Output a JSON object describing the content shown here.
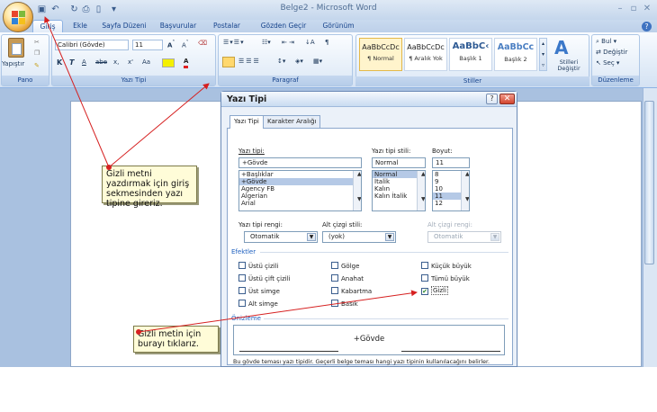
{
  "window": {
    "title": "Belge2 - Microsoft Word",
    "min": "–",
    "max": "▫",
    "close": "✕"
  },
  "tabs": [
    {
      "label": "Giriş"
    },
    {
      "label": "Ekle"
    },
    {
      "label": "Sayfa Düzeni"
    },
    {
      "label": "Başvurular"
    },
    {
      "label": "Postalar"
    },
    {
      "label": "Gözden Geçir"
    },
    {
      "label": "Görünüm"
    }
  ],
  "ribbon": {
    "pano": {
      "label": "Pano",
      "paste": "Yapıştır"
    },
    "font": {
      "label": "Yazı Tipi",
      "name": "Calibri (Gövde)",
      "size": "11",
      "bold": "K",
      "italic": "T",
      "underline": "A",
      "strike": "abe",
      "sub": "x,",
      "sup": "x'",
      "case": "Aa"
    },
    "paragraph": {
      "label": "Paragraf"
    },
    "styles": {
      "label": "Stiller",
      "items": [
        {
          "sample": "AaBbCcDc",
          "name": "¶ Normal"
        },
        {
          "sample": "AaBbCcDc",
          "name": "¶ Aralık Yok"
        },
        {
          "sample": "AaBbC‹",
          "name": "Başlık 1"
        },
        {
          "sample": "AaBbCc",
          "name": "Başlık 2"
        }
      ],
      "change": "Stilleri Değiştir"
    },
    "editing": {
      "label": "Düzenleme",
      "find": "Bul",
      "replace": "Değiştir",
      "select": "Seç"
    }
  },
  "dialog": {
    "title": "Yazı Tipi",
    "tabs": [
      "Yazı Tipi",
      "Karakter Aralığı"
    ],
    "font_label": "Yazı tipi:",
    "font_value": "+Gövde",
    "font_list": [
      "+Başlıklar",
      "+Gövde",
      "Agency FB",
      "Algerian",
      "Arial"
    ],
    "style_label": "Yazı tipi stili:",
    "style_value": "Normal",
    "style_list": [
      "Normal",
      "İtalik",
      "Kalın",
      "Kalın İtalik"
    ],
    "size_label": "Boyut:",
    "size_value": "11",
    "size_list": [
      "8",
      "9",
      "10",
      "11",
      "12"
    ],
    "color_label": "Yazı tipi rengi:",
    "color_value": "Otomatik",
    "underline_label": "Alt çizgi stili:",
    "underline_value": "(yok)",
    "ucolor_label": "Alt çizgi rengi:",
    "ucolor_value": "Otomatik",
    "effects_label": "Efektler",
    "effects": [
      {
        "label": "Üstü çizili",
        "checked": false
      },
      {
        "label": "Gölge",
        "checked": false
      },
      {
        "label": "Küçük büyük",
        "checked": false
      },
      {
        "label": "Üstü çift çizili",
        "checked": false
      },
      {
        "label": "Anahat",
        "checked": false
      },
      {
        "label": "Tümü büyük",
        "checked": false
      },
      {
        "label": "Üst simge",
        "checked": false
      },
      {
        "label": "Kabartma",
        "checked": false
      },
      {
        "label": "Gizli",
        "checked": true
      },
      {
        "label": "Alt simge",
        "checked": false
      },
      {
        "label": "Basık",
        "checked": false
      }
    ],
    "preview_label": "Önizleme",
    "preview_text": "+Gövde",
    "description": "Bu gövde teması yazı tipidir. Geçerli belge teması hangi yazı tipinin kullanılacağını belirler."
  },
  "callouts": {
    "top": "Gizli metni yazdırmak için giriş sekmesinden yazı tipine gireriz.",
    "bottom": "Gizli metin için burayı tıklarız."
  }
}
